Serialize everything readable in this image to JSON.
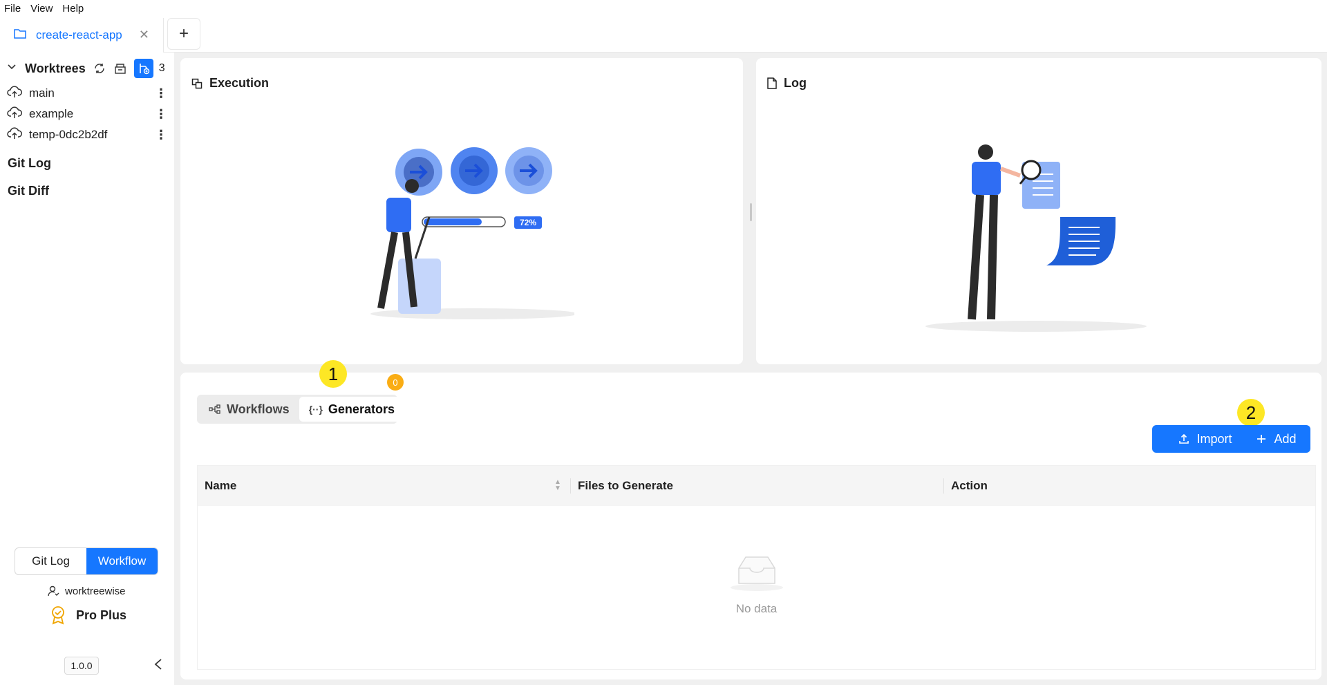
{
  "menu": {
    "items": [
      "File",
      "View",
      "Help"
    ]
  },
  "tabs": {
    "active_label": "create-react-app",
    "new_tab_label": "+"
  },
  "sidebar": {
    "worktrees_title": "Worktrees",
    "worktree_count": "3",
    "worktrees": [
      {
        "name": "main"
      },
      {
        "name": "example"
      },
      {
        "name": "temp-0dc2b2df"
      }
    ],
    "git_log_title": "Git Log",
    "git_diff_title": "Git Diff",
    "mode_options": [
      "Git Log",
      "Workflow"
    ],
    "mode_selected": "Workflow",
    "username": "worktreewise",
    "plan": "Pro Plus",
    "version": "1.0.0"
  },
  "execution": {
    "title": "Execution",
    "progress_label": "72%",
    "progress": 72
  },
  "log": {
    "title": "Log"
  },
  "bottom": {
    "tabs": [
      "Workflows",
      "Generators"
    ],
    "active_tab": "Generators",
    "generators_badge": "0",
    "marker_1": "1",
    "marker_2": "2",
    "import_label": "Import",
    "add_label": "Add",
    "table": {
      "columns": [
        "Name",
        "Files to Generate",
        "Action"
      ],
      "rows": [],
      "empty_text": "No data"
    }
  },
  "colors": {
    "accent": "#1677ff",
    "badge": "#faad14",
    "marker": "#fde725"
  }
}
